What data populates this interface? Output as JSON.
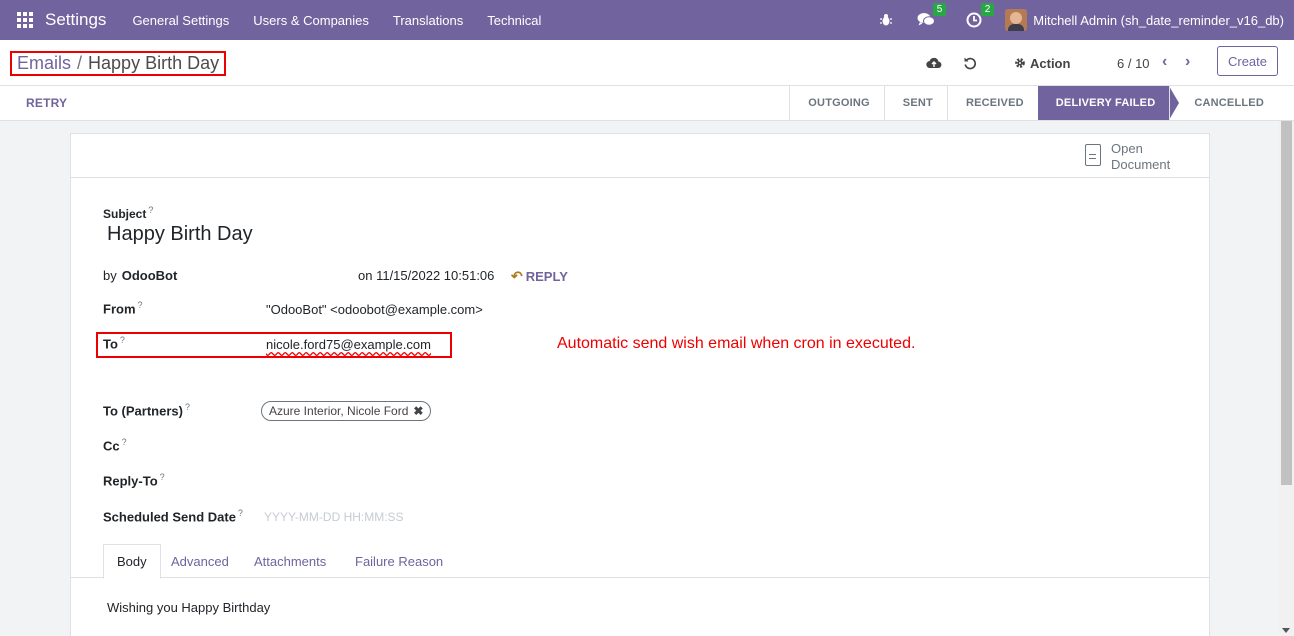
{
  "navbar": {
    "app_title": "Settings",
    "menu": [
      "General Settings",
      "Users & Companies",
      "Translations",
      "Technical"
    ],
    "messages_count": "5",
    "activities_count": "2",
    "user_name": "Mitchell Admin (sh_date_reminder_v16_db)",
    "accent_color": "#71639e"
  },
  "control": {
    "breadcrumb_parent": "Emails",
    "breadcrumb_separator": "/",
    "breadcrumb_current": "Happy Birth Day",
    "action_label": "Action",
    "pager": "6 / 10",
    "create_label": "Create"
  },
  "statusbar": {
    "retry_label": "RETRY",
    "stages": [
      "OUTGOING",
      "SENT",
      "RECEIVED",
      "DELIVERY FAILED",
      "CANCELLED"
    ],
    "active_stage": "DELIVERY FAILED"
  },
  "sheet": {
    "open_document_line1": "Open",
    "open_document_line2": "Document",
    "subject_label": "Subject",
    "subject_value": "Happy Birth Day",
    "by_prefix": "by",
    "author": "OdooBot",
    "date_text": "on 11/15/2022 10:51:06",
    "reply_label": "REPLY",
    "from_label": "From",
    "from_value": "\"OdooBot\" <odoobot@example.com>",
    "to_label": "To",
    "to_value": "nicole.ford75@example.com",
    "annotation": "Automatic send wish email when cron in executed.",
    "to_partners_label": "To (Partners)",
    "partner_tag": "Azure Interior, Nicole Ford",
    "cc_label": "Cc",
    "reply_to_label": "Reply-To",
    "scheduled_label": "Scheduled Send Date",
    "scheduled_placeholder": "YYYY-MM-DD HH:MM:SS",
    "help_mark": "?",
    "tabs": [
      "Body",
      "Advanced",
      "Attachments",
      "Failure Reason"
    ],
    "active_tab": "Body",
    "body_text": "Wishing you Happy Birthday"
  }
}
